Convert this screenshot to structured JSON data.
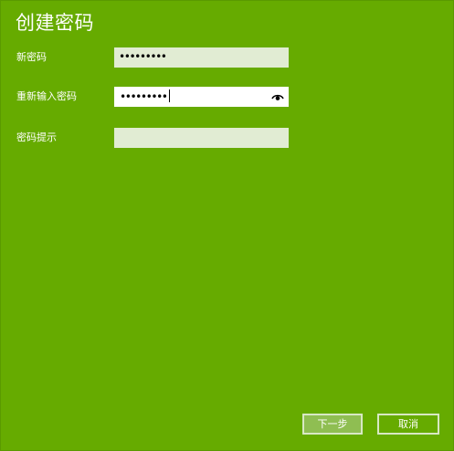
{
  "dialog": {
    "title": "创建密码"
  },
  "fields": [
    {
      "label": "新密码",
      "value": "•••••••••",
      "placeholder": ""
    },
    {
      "label": "重新输入密码",
      "value": "•••••••••",
      "placeholder": ""
    },
    {
      "label": "密码提示",
      "value": "",
      "placeholder": ""
    }
  ],
  "buttons": {
    "next_label": "下一步",
    "cancel_label": "取消"
  },
  "icons": {
    "reveal_password": "eye-icon"
  },
  "colors": {
    "background": "#66ab00",
    "inactive_input": "#e1ecd3",
    "active_input": "#ffffff",
    "button_border": "#d8e8c4",
    "next_button_fill": "#8fbe52"
  }
}
